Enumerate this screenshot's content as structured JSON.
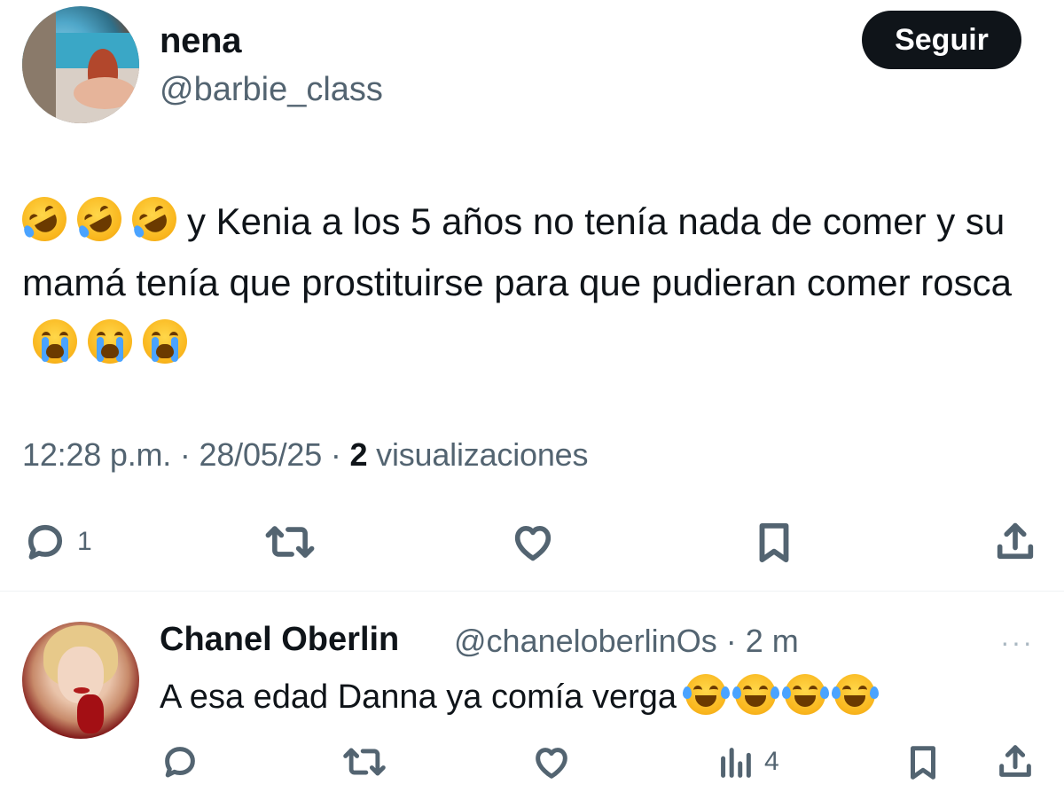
{
  "tweet": {
    "author": {
      "name": "nena",
      "handle": "@barbie_class"
    },
    "follow_label": "Seguir",
    "text": "y Kenia a los 5 años no tenía nada de comer y su mamá tenía que prostituirse para que pudieran comer rosca",
    "leading_emoji": [
      "rolling-on-floor-laughing",
      "rolling-on-floor-laughing",
      "rolling-on-floor-laughing"
    ],
    "trailing_emoji": [
      "loudly-crying-face",
      "loudly-crying-face",
      "loudly-crying-face"
    ],
    "time": "12:28 p.m.",
    "date": "28/05/25",
    "views_count": "2",
    "views_label": "visualizaciones",
    "separator": "·",
    "actions": {
      "reply_count": "1"
    }
  },
  "reply": {
    "author": {
      "name": "Chanel Oberlin",
      "handle": "@chaneloberlinOs · 2 m"
    },
    "more_label": "···",
    "text": "A esa edad Danna ya comía verga",
    "trailing_emoji": [
      "face-with-tears-of-joy",
      "face-with-tears-of-joy",
      "face-with-tears-of-joy",
      "face-with-tears-of-joy"
    ],
    "actions": {
      "views_count": "4"
    }
  },
  "colors": {
    "text_primary": "#0f1419",
    "text_secondary": "#536471",
    "follow_button_bg": "#0f1419",
    "divider": "#eff3f4"
  }
}
